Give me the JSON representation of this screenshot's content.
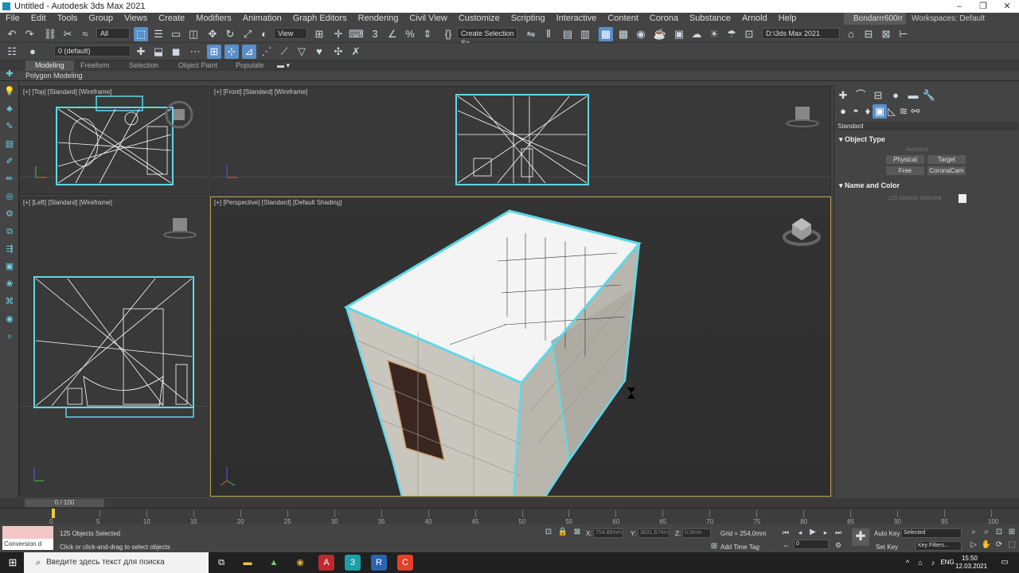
{
  "window": {
    "title": "Untitled - Autodesk 3ds Max 2021"
  },
  "menu": [
    "File",
    "Edit",
    "Tools",
    "Group",
    "Views",
    "Create",
    "Modifiers",
    "Animation",
    "Graph Editors",
    "Rendering",
    "Civil View",
    "Customize",
    "Scripting",
    "Interactive",
    "Content",
    "Corona",
    "Substance",
    "Arnold",
    "Help"
  ],
  "user": {
    "name": "Bondarrr600rr",
    "workspace_label": "Workspaces: Default"
  },
  "toolbar": {
    "filter": "All",
    "refcoord": "View",
    "selection_set": "Create Selection Se",
    "path": "D:\\3ds Max 2021",
    "layer": "0 (default)"
  },
  "ribbon": {
    "tabs": [
      "Modeling",
      "Freeform",
      "Selection",
      "Object Paint",
      "Populate"
    ],
    "active": "Modeling",
    "sub": "Polygon Modeling"
  },
  "viewports": {
    "top": "[+] [Top] [Standard] [Wireframe]",
    "front": "[+] [Front] [Standard] [Wireframe]",
    "left": "[+] [Left] [Standard] [Wireframe]",
    "perspective": "[+] [Perspective] [Standard] [Default Shading]"
  },
  "command_panel": {
    "category": "Standard",
    "object_type_title": "Object Type",
    "autogrid": "AutoGrid",
    "buttons": [
      "Physical",
      "Target",
      "Free",
      "CoronaCam"
    ],
    "name_color_title": "Name and Color",
    "name_value": "125 Objects Selected"
  },
  "timeline": {
    "frame": "0 / 100",
    "ticks": [
      "0",
      "5",
      "10",
      "15",
      "20",
      "25",
      "30",
      "35",
      "40",
      "45",
      "50",
      "55",
      "60",
      "65",
      "70",
      "75",
      "80",
      "85",
      "90",
      "95",
      "100"
    ]
  },
  "status": {
    "script": "Conversion d",
    "selected": "125 Objects Selected",
    "prompt": "Click or click-and-drag to select objects",
    "x_label": "X:",
    "x": "754,85mm",
    "y_label": "Y:",
    "y": "3631,674m",
    "z_label": "Z:",
    "z": "0,0mm",
    "grid": "Grid = 254,0mm",
    "add_time_tag": "Add Time Tag",
    "auto_key": "Auto Key",
    "set_key": "Set Key",
    "key_mode": "Selected",
    "key_filters": "Key Filters...",
    "frame_field": "0"
  },
  "taskbar": {
    "search_placeholder": "Введите здесь текст для поиска",
    "lang": "ENG",
    "time": "15:50",
    "date": "12.03.2021"
  },
  "colors": {
    "accent": "#5a8fc9",
    "selection": "#5fd8e8",
    "persp_border": "#b8a24a"
  }
}
